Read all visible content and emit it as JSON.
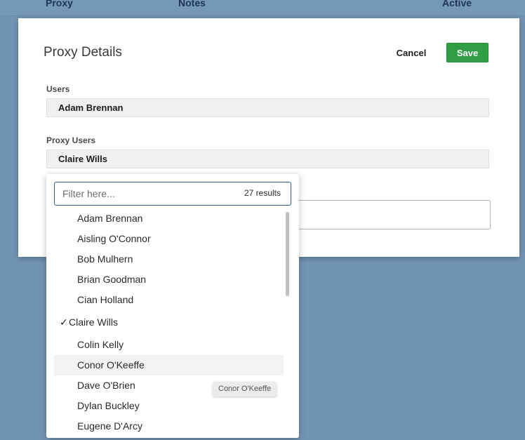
{
  "background_table": {
    "columns": [
      "Proxy",
      "Notes",
      "Active"
    ]
  },
  "modal": {
    "title": "Proxy Details",
    "cancel_label": "Cancel",
    "save_label": "Save",
    "users_label": "Users",
    "users_value": "Adam Brennan",
    "proxy_users_label": "Proxy Users",
    "proxy_users_value": "Claire Wills",
    "notes_value": ""
  },
  "dropdown": {
    "filter_placeholder": "Filter here...",
    "filter_value": "",
    "result_count": "27 results",
    "selected": "Claire Wills",
    "hovered": "Conor O'Keeffe",
    "options": [
      "Adam Brennan",
      "Aisling O'Connor",
      "Bob Mulhern",
      "Brian Goodman",
      "Cian Holland",
      "Claire Wills",
      "Colin Kelly",
      "Conor O'Keeffe",
      "Dave O'Brien",
      "Dylan Buckley",
      "Eugene D'Arcy"
    ],
    "check_icon": "check-icon"
  },
  "tooltip": {
    "text": "Conor O'Keeffe"
  }
}
